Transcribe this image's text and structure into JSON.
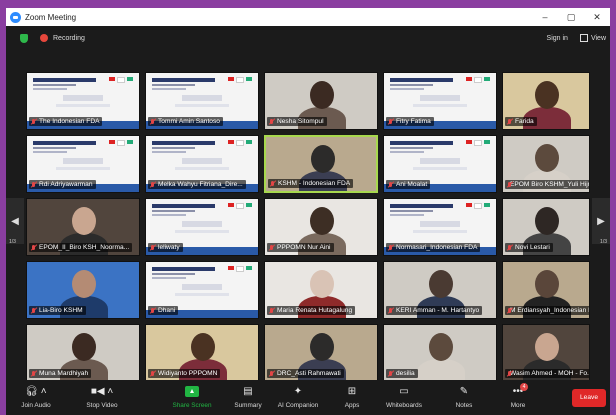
{
  "window": {
    "title": "Zoom Meeting",
    "minimize": "–",
    "restore": "▢",
    "close": "✕"
  },
  "topbar": {
    "recording_label": "Recording",
    "sign_in": "Sign in",
    "view": "View"
  },
  "gallery": {
    "page_left": "1/3",
    "page_right": "1/3",
    "tiles": [
      {
        "name": "The Indonesian FDA",
        "kind": "slide"
      },
      {
        "name": "Tommi Amin Santoso",
        "kind": "slide"
      },
      {
        "name": "Nesha Sitompul",
        "kind": "cam"
      },
      {
        "name": "Fitry Fatima",
        "kind": "slide"
      },
      {
        "name": "Farida",
        "kind": "cam"
      },
      {
        "name": "Rdi Adriyawarman",
        "kind": "slide"
      },
      {
        "name": "Melka Wahyu Fitriana_Dire...",
        "kind": "slide"
      },
      {
        "name": "KSHM - Indonesian FDA",
        "kind": "cam"
      },
      {
        "name": "Ani Moalat",
        "kind": "slide"
      },
      {
        "name": "EPOM Biro KSHM_Yuli Hijr...",
        "kind": "cam"
      },
      {
        "name": "EPOM_II_Biro KSH_Noorma...",
        "kind": "cam"
      },
      {
        "name": "leliwaty",
        "kind": "slide"
      },
      {
        "name": "PPPOMN Nur Aini",
        "kind": "cam"
      },
      {
        "name": "Normasari_Indonesian FDA",
        "kind": "slide"
      },
      {
        "name": "Novi Lestari",
        "kind": "cam"
      },
      {
        "name": "Lia-Biro KSHM",
        "kind": "cam"
      },
      {
        "name": "Dhani",
        "kind": "slide"
      },
      {
        "name": "Maria Renata Hutagalung",
        "kind": "cam"
      },
      {
        "name": "KERI Amman - M. Hartantyo",
        "kind": "cam"
      },
      {
        "name": "M Erdiansyah_Indonesian FDA",
        "kind": "cam"
      },
      {
        "name": "Muna Mardhiyah",
        "kind": "cam"
      },
      {
        "name": "Widiyanto PPPOMN",
        "kind": "cam"
      },
      {
        "name": "DRC_Asti Rahmawati",
        "kind": "cam"
      },
      {
        "name": "desilia",
        "kind": "cam"
      },
      {
        "name": "Wasim Ahmed - MOH - Fo...",
        "kind": "cam"
      }
    ]
  },
  "toolbar": {
    "join_audio": "Join Audio",
    "stop_video": "Stop Video",
    "share_screen": "Share Screen",
    "summary": "Summary",
    "ai_companion": "AI Companion",
    "apps": "Apps",
    "whiteboards": "Whiteboards",
    "notes": "Notes",
    "more": "More",
    "more_badge": "4",
    "leave": "Leave"
  },
  "colors": {
    "accent_purple": "#8a3ea0",
    "share_green": "#21b543",
    "leave_red": "#e02828",
    "active_speaker": "#a8d84e"
  }
}
